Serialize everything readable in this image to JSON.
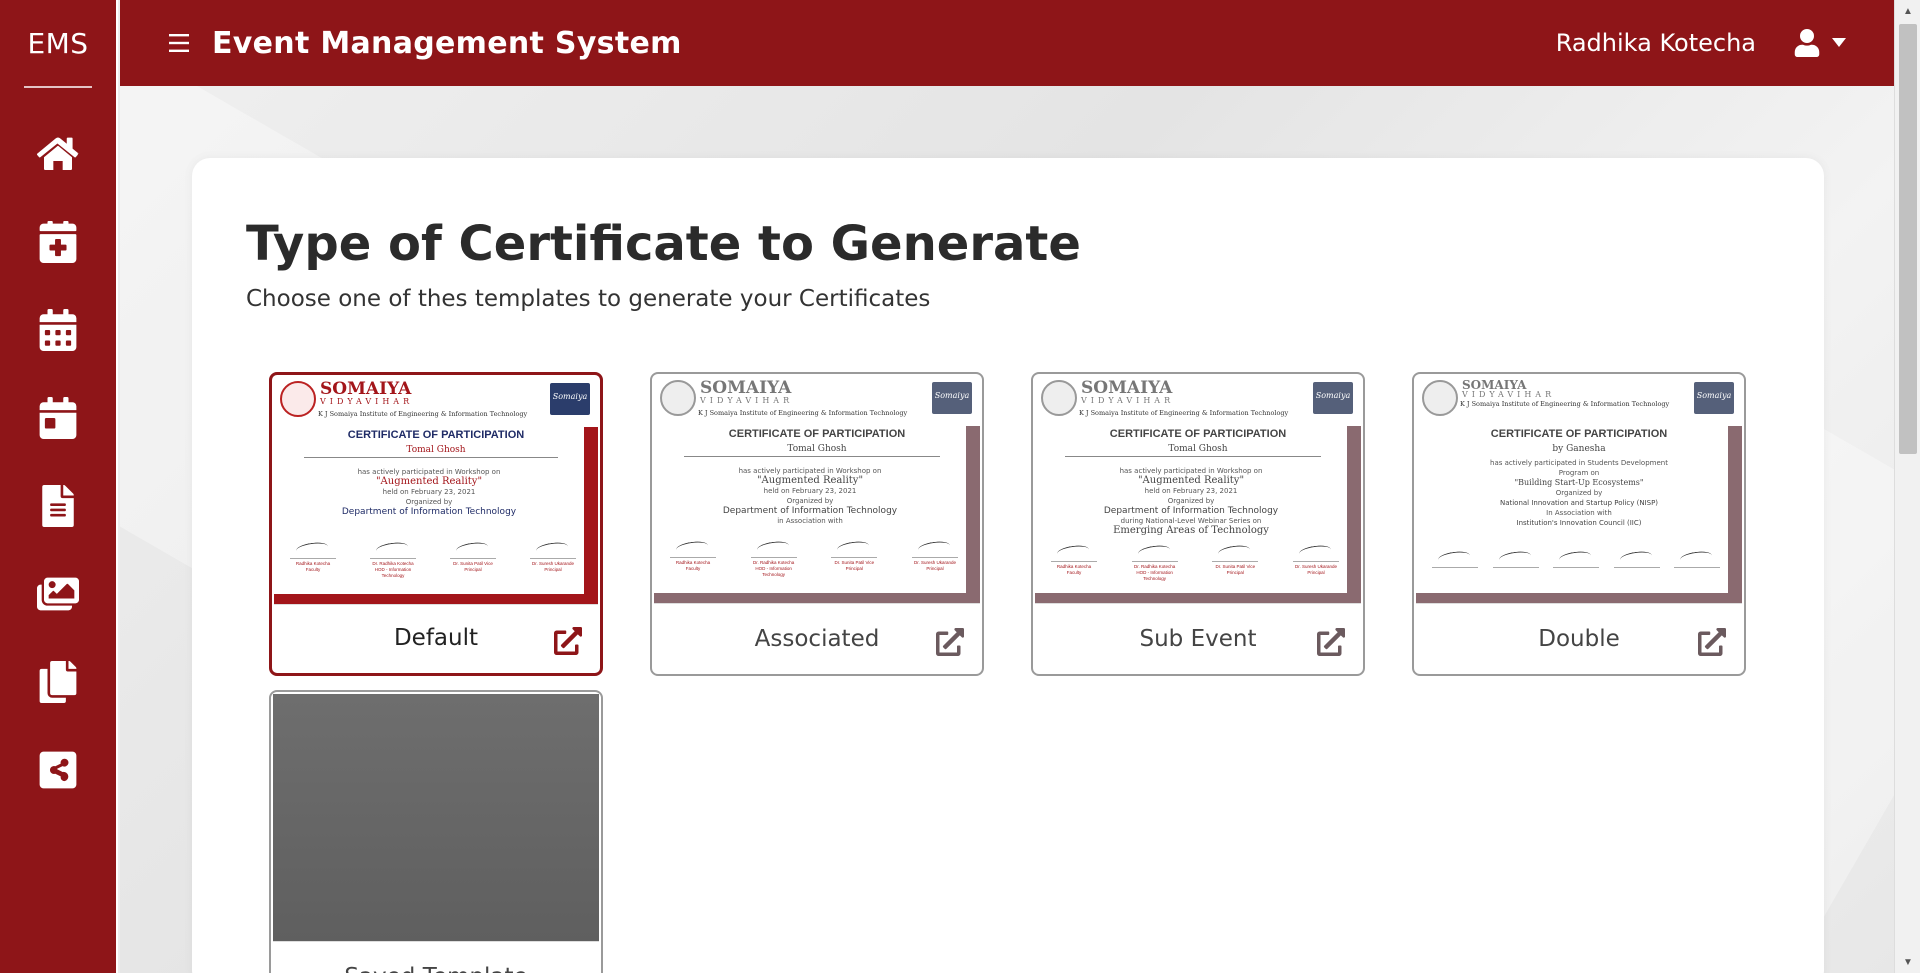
{
  "sidebar": {
    "brand": "EMS",
    "items": [
      {
        "icon": "home-icon"
      },
      {
        "icon": "calendar-plus-icon"
      },
      {
        "icon": "calendar-icon"
      },
      {
        "icon": "calendar-day-icon"
      },
      {
        "icon": "document-icon"
      },
      {
        "icon": "images-icon"
      },
      {
        "icon": "copy-icon"
      },
      {
        "icon": "share-icon"
      }
    ]
  },
  "header": {
    "title": "Event Management System",
    "user_name": "Radhika Kotecha"
  },
  "main": {
    "title": "Type of Certificate to Generate",
    "subtitle": "Choose one of thes templates to generate your Certificates",
    "templates": [
      {
        "label": "Default",
        "selected": true
      },
      {
        "label": "Associated",
        "selected": false
      },
      {
        "label": "Sub Event",
        "selected": false
      },
      {
        "label": "Double",
        "selected": false
      },
      {
        "label": "Saved Template",
        "selected": false
      }
    ]
  },
  "certificate_preview": {
    "org": "SOMAIYA",
    "org_sub": "VIDYAVIHAR",
    "institute": "K J Somaiya Institute of Engineering & Information Technology",
    "trust_logo": "Somaiya",
    "heading": "CERTIFICATE OF PARTICIPATION",
    "name": "Tomal Ghosh",
    "participated": "has actively participated in Workshop on",
    "topic": "\"Augmented Reality\"",
    "held": "held on February 23, 2021",
    "organized_by": "Organized by",
    "department": "Department of Information Technology",
    "in_association": "in Association with",
    "sub_event_line": "during National-Level Webinar Series on",
    "sub_event_title": "Emerging Areas of Technology",
    "signatories": [
      "Radhika Kotecha Faculty",
      "Dr. Radhika Kotecha HOD - Information Technology",
      "Dr. Sunita Patil Vice Principal",
      "Dr. Suresh Ukarande Principal"
    ],
    "double": {
      "name": "by Ganesha",
      "participated": "has actively participated in Students Development Program on",
      "topic": "\"Building Start-Up Ecosystems\"",
      "organized_by": "National Innovation and Startup Policy (NISP)",
      "in_association": "In Association with",
      "council": "Institution's Innovation Council (IIC)"
    }
  },
  "colors": {
    "brand": "#8e1518",
    "accent": "#a3151a"
  }
}
